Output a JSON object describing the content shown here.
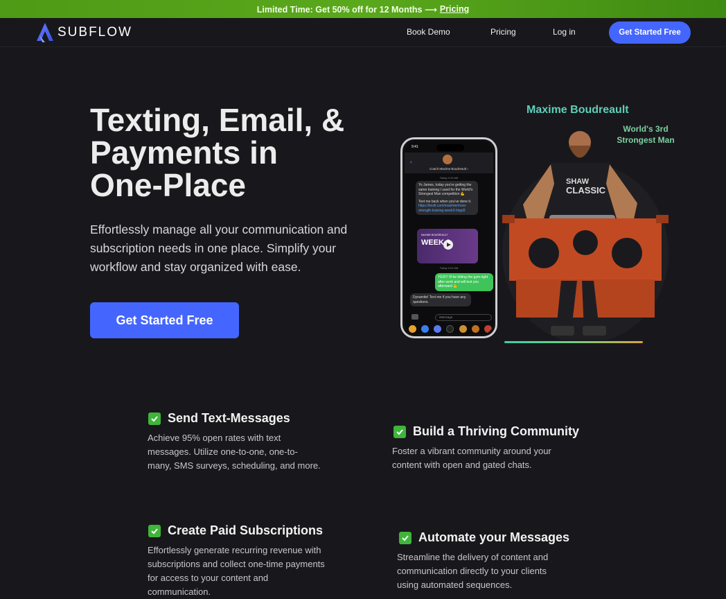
{
  "promo": {
    "text": "Limited Time: Get 50% off for 12 Months ⟶",
    "link": "Pricing"
  },
  "nav": {
    "brand": "SUBFLOW",
    "links": [
      "Book Demo",
      "Pricing",
      "Log in"
    ],
    "cta": "Get Started Free"
  },
  "hero": {
    "title_lines": [
      "Texting, Email, &",
      "Payments in",
      "One-Place"
    ],
    "subtitle": "Effortlessly manage all your communication and subscription needs in one place. Simplify your workflow and stay organized with ease.",
    "cta": "Get Started Free",
    "athlete_name": "Maxime Boudreault",
    "athlete_title": "World's 3rd Strongest Man"
  },
  "phone": {
    "time": "9:41",
    "contact": "Coach Maxime Boudreault ›",
    "ts1": "Today 9:10 AM",
    "msg1": "Yo James, today you're getting the same training I used for the World's Strongest Man competition 💪",
    "msg1b": "Text me back when you've done it.",
    "msg1_link": "https://boxlt.com/maxime/more-strength-training-week3-hkgd3",
    "video_brand": "MAXIME BOUDREAULT",
    "video_label": "WEEK 3",
    "ts2": "Today 9:22 AM",
    "msg2": "YES!!! I'll be hitting the gym right after work and will text you afterward 💪",
    "msg3": "Dynamite! Text me if you have any questions.",
    "input_placeholder": "iMessage"
  },
  "features": [
    {
      "title": "Send Text-Messages",
      "desc": "Achieve 95% open rates with text messages. Utilize one-to-one, one-to-many, SMS surveys, scheduling, and more."
    },
    {
      "title": "Build a Thriving Community",
      "desc": "Foster a vibrant community around your content with open and gated chats."
    },
    {
      "title": "Create Paid Subscriptions",
      "desc": "Effortlessly generate recurring revenue with subscriptions and collect one-time payments for access to your content and communication."
    },
    {
      "title": "Automate your Messages",
      "desc": "Streamline the delivery of content and communication directly to your clients using automated sequences."
    }
  ],
  "colors": {
    "background": "#18181c",
    "accent": "#4466ff",
    "promo_green": "#5aa81c",
    "check_green": "#3fb53a"
  }
}
